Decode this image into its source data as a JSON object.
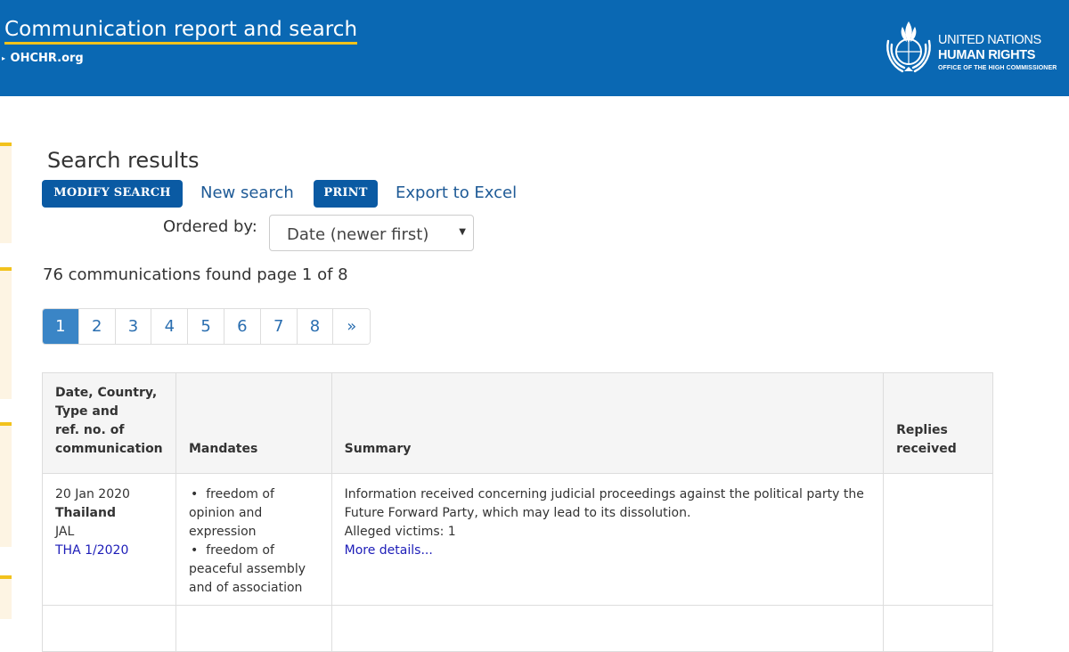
{
  "header": {
    "title": "Communication report and search",
    "breadcrumb": "OHCHR.org",
    "logo_line1": "UNITED NATIONS",
    "logo_line2": "HUMAN RIGHTS",
    "logo_line3": "OFFICE OF THE HIGH COMMISSIONER"
  },
  "main": {
    "page_title": "Search results",
    "modify_search_label": "MODIFY SEARCH",
    "new_search_label": "New search",
    "print_label": "PRINT",
    "export_label": "Export to Excel",
    "ordered_by_label": "Ordered by:",
    "ordered_by_value": "Date (newer first)",
    "results_count": "76 communications found page 1 of 8"
  },
  "pagination": {
    "pages": [
      "1",
      "2",
      "3",
      "4",
      "5",
      "6",
      "7",
      "8",
      "»"
    ],
    "current": "1"
  },
  "table": {
    "headers": {
      "col1": [
        "Date, Country,",
        "Type and",
        "ref. no. of",
        "communication"
      ],
      "col2": "Mandates",
      "col3": "Summary",
      "col4": [
        "Replies",
        "received"
      ]
    },
    "rows": [
      {
        "date": "20 Jan 2020",
        "country": "Thailand",
        "type": "JAL",
        "ref": "THA 1/2020",
        "mandates": [
          "freedom of opinion and expression",
          "freedom of peaceful assembly and of association"
        ],
        "summary": "Information received concerning judicial proceedings against the political party the Future Forward Party, which may lead to its dissolution.",
        "victims": "Alleged victims: 1",
        "more_details": "More details...",
        "replies": ""
      }
    ]
  },
  "colors": {
    "header_bg": "#0a68b3",
    "accent_underline": "#f2c21c",
    "button_bg": "#0a5aa3",
    "link": "#1e5a96",
    "active_page": "#3a85c6"
  }
}
